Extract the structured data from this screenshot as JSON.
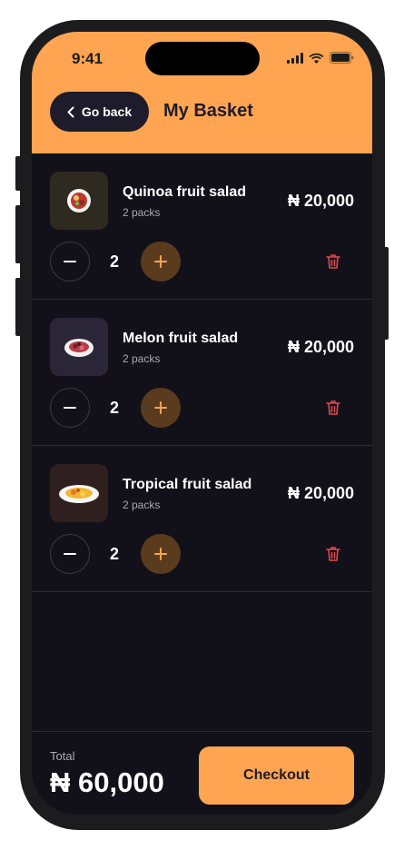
{
  "status_bar": {
    "time": "9:41"
  },
  "header": {
    "back_label": "Go back",
    "title": "My Basket"
  },
  "items": [
    {
      "name": "Quinoa fruit salad",
      "packs": "2 packs",
      "price": "₦ 20,000",
      "quantity": "2",
      "thumb_bg": "#2f2a1f"
    },
    {
      "name": "Melon fruit salad",
      "packs": "2 packs",
      "price": "₦ 20,000",
      "quantity": "2",
      "thumb_bg": "#2a2638"
    },
    {
      "name": "Tropical fruit salad",
      "packs": "2 packs",
      "price": "₦ 20,000",
      "quantity": "2",
      "thumb_bg": "#2f1f1f"
    }
  ],
  "footer": {
    "total_label": "Total",
    "total_value": "₦ 60,000",
    "checkout_label": "Checkout"
  },
  "colors": {
    "accent": "#ffa451",
    "background": "#12111a",
    "delete": "#e5484d"
  }
}
